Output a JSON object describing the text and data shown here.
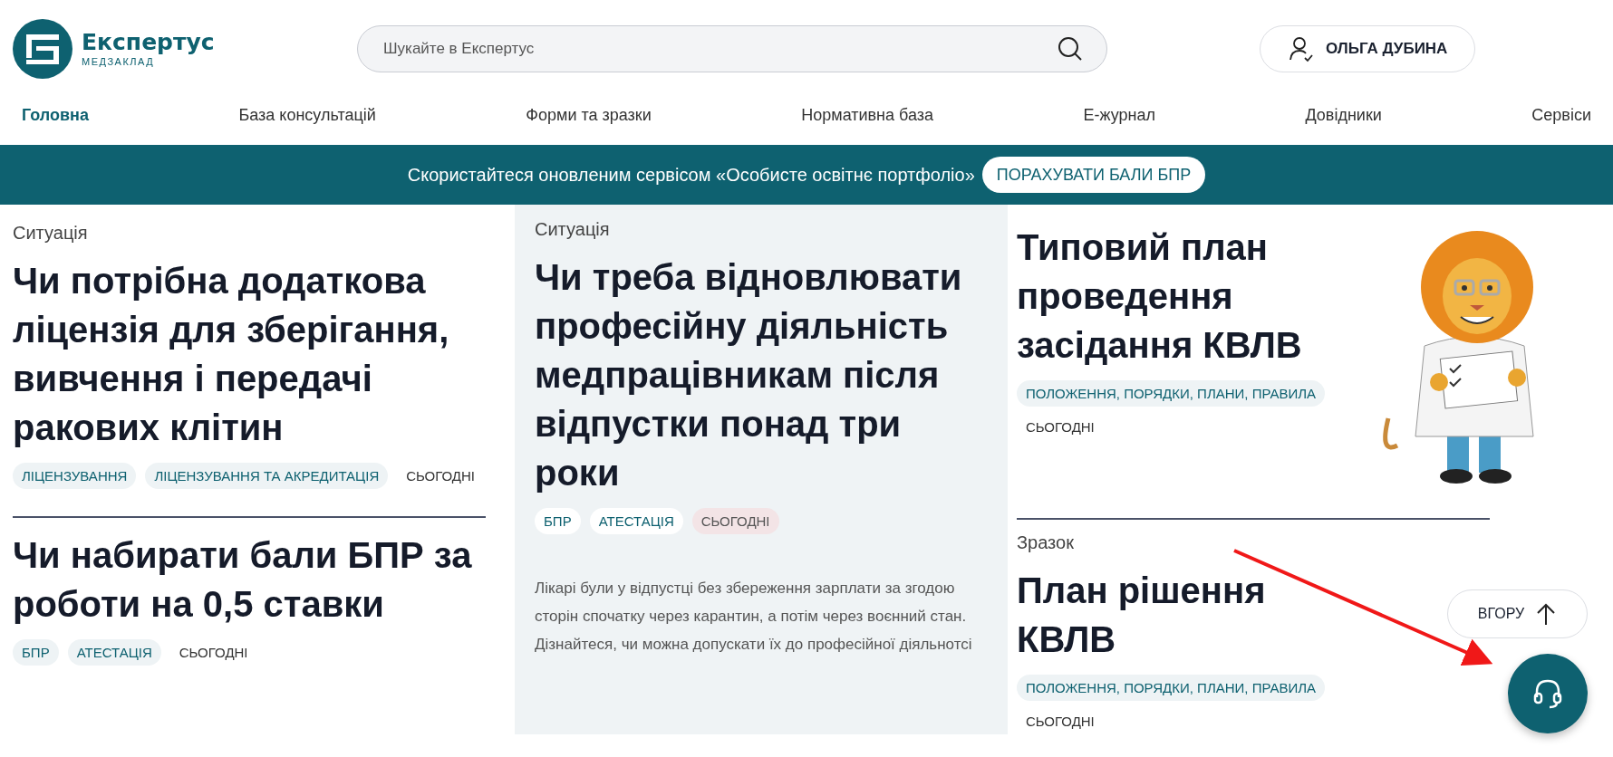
{
  "logo": {
    "name": "Експертус",
    "subtitle": "МЕДЗАКЛАД"
  },
  "search": {
    "placeholder": "Шукайте в Експертус"
  },
  "user": {
    "name": "ОЛЬГА ДУБИНА"
  },
  "nav": [
    {
      "label": "Головна",
      "selected": true
    },
    {
      "label": "База консультацій",
      "selected": false
    },
    {
      "label": "Форми та зразки",
      "selected": false
    },
    {
      "label": "Нормативна база",
      "selected": false
    },
    {
      "label": "Е-журнал",
      "selected": false
    },
    {
      "label": "Довідники",
      "selected": false
    },
    {
      "label": "Сервіси",
      "selected": false
    }
  ],
  "banner": {
    "text": "Скористайтеся оновленим сервісом «Особисте освітнє портфоліо»",
    "button": "ПОРАХУВАТИ БАЛИ БПР"
  },
  "columns": [
    {
      "highlighted": false,
      "articles": [
        {
          "category": "Ситуація",
          "title": "Чи потрібна додаткова ліцензія для зберігання, вивчення і передачі ракових клітин",
          "tags": [
            {
              "kind": "topic",
              "text": "ЛІЦЕНЗУВАННЯ"
            },
            {
              "kind": "topic",
              "text": "ЛІЦЕНЗУВАННЯ ТА АКРЕДИТАЦІЯ"
            },
            {
              "kind": "date",
              "text": "СЬОГОДНІ"
            }
          ]
        },
        {
          "title": "Чи набирати бали БПР за роботи на 0,5 ставки",
          "tags": [
            {
              "kind": "topic",
              "text": "БПР"
            },
            {
              "kind": "topic",
              "text": "АТЕСТАЦІЯ"
            },
            {
              "kind": "date",
              "text": "СЬОГОДНІ"
            }
          ]
        }
      ]
    },
    {
      "highlighted": true,
      "articles": [
        {
          "category": "Ситуація",
          "title": "Чи треба відновлювати професійну діяльність медпрацівникам після відпустки понад три роки",
          "tags": [
            {
              "kind": "topic",
              "text": "БПР"
            },
            {
              "kind": "topic",
              "text": "АТЕСТАЦІЯ"
            },
            {
              "kind": "date-new",
              "text": "СЬОГОДНІ"
            }
          ],
          "summary": "Лікарі були у відпустці без збереження зарплати за згодою сторін спочатку через карантин, а потім через воєнний стан. Дізнайтеся, чи можна допускати їх до професійної діяльнотсі"
        }
      ]
    },
    {
      "highlighted": false,
      "articles": [
        {
          "title": "Типовий план проведення засідання КВЛВ",
          "tags": [
            {
              "kind": "topic",
              "text": "ПОЛОЖЕННЯ, ПОРЯДКИ, ПЛАНИ, ПРАВИЛА"
            },
            {
              "kind": "date",
              "text": "СЬОГОДНІ"
            }
          ],
          "illustration": true
        },
        {
          "category": "Зразок",
          "title": "План рішення КВЛВ",
          "tags": [
            {
              "kind": "topic",
              "text": "ПОЛОЖЕННЯ, ПОРЯДКИ, ПЛАНИ, ПРАВИЛА"
            },
            {
              "kind": "date",
              "text": "СЬОГОДНІ"
            }
          ]
        }
      ]
    }
  ],
  "scroll_top": {
    "label": "ВГОРУ"
  }
}
